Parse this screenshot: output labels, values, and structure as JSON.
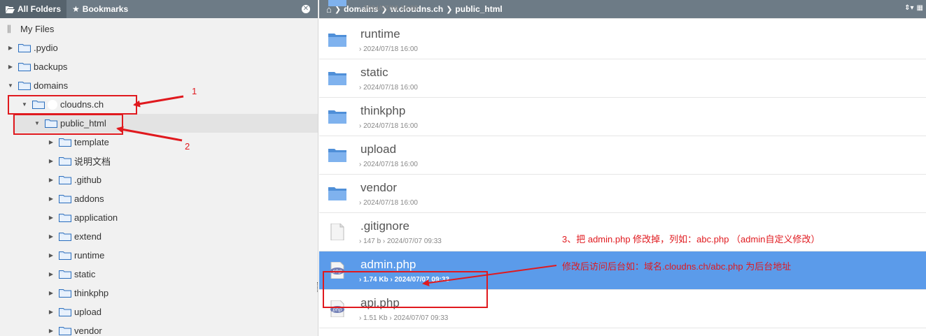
{
  "left_panel": {
    "tab_all_folders": "All Folders",
    "tab_bookmarks": "Bookmarks",
    "root_label": "My Files",
    "tree": [
      {
        "label": ".pydio",
        "caret": "▶"
      },
      {
        "label": "backups",
        "caret": "▶"
      },
      {
        "label": "domains",
        "caret": "▼"
      },
      {
        "label": "cloudns.ch",
        "caret": "▼"
      },
      {
        "label": "public_html",
        "caret": "▼"
      },
      {
        "label": "template",
        "caret": "▶"
      },
      {
        "label": "说明文档",
        "caret": "▶"
      },
      {
        "label": ".github",
        "caret": "▶"
      },
      {
        "label": "addons",
        "caret": "▶"
      },
      {
        "label": "application",
        "caret": "▶"
      },
      {
        "label": "extend",
        "caret": "▶"
      },
      {
        "label": "runtime",
        "caret": "▶"
      },
      {
        "label": "static",
        "caret": "▶"
      },
      {
        "label": "thinkphp",
        "caret": "▶"
      },
      {
        "label": "upload",
        "caret": "▶"
      },
      {
        "label": "vendor",
        "caret": "▶"
      }
    ]
  },
  "breadcrumb": {
    "segments": [
      "domains",
      "w.cloudns.ch",
      "public_html"
    ],
    "separator": "❯"
  },
  "files": [
    {
      "name": "",
      "meta": "› 2024/07/18 16:00",
      "type": "folder"
    },
    {
      "name": "runtime",
      "meta": "› 2024/07/18 16:00",
      "type": "folder"
    },
    {
      "name": "static",
      "meta": "› 2024/07/18 16:00",
      "type": "folder"
    },
    {
      "name": "thinkphp",
      "meta": "› 2024/07/18 16:00",
      "type": "folder"
    },
    {
      "name": "upload",
      "meta": "› 2024/07/18 16:00",
      "type": "folder"
    },
    {
      "name": "vendor",
      "meta": "› 2024/07/18 16:00",
      "type": "folder"
    },
    {
      "name": ".gitignore",
      "meta": "› 147 b › 2024/07/07 09:33",
      "type": "file"
    },
    {
      "name": "admin.php",
      "meta": "› 1.74 Kb › 2024/07/07 09:33",
      "type": "php"
    },
    {
      "name": "api.php",
      "meta": "› 1.51 Kb › 2024/07/07 09:33",
      "type": "php"
    }
  ],
  "annotations": {
    "label_1": "1",
    "label_2": "2",
    "note_3": "3、把 admin.php 修改掉，列如：abc.php （admin自定义修改）",
    "note_4": "修改后访问后台如：域名.cloudns.ch/abc.php 为后台地址"
  },
  "colors": {
    "header": "#6d7b86",
    "selected_row": "#5b9bea",
    "annotation": "#e0191e",
    "folder": "#4f8fd8"
  }
}
